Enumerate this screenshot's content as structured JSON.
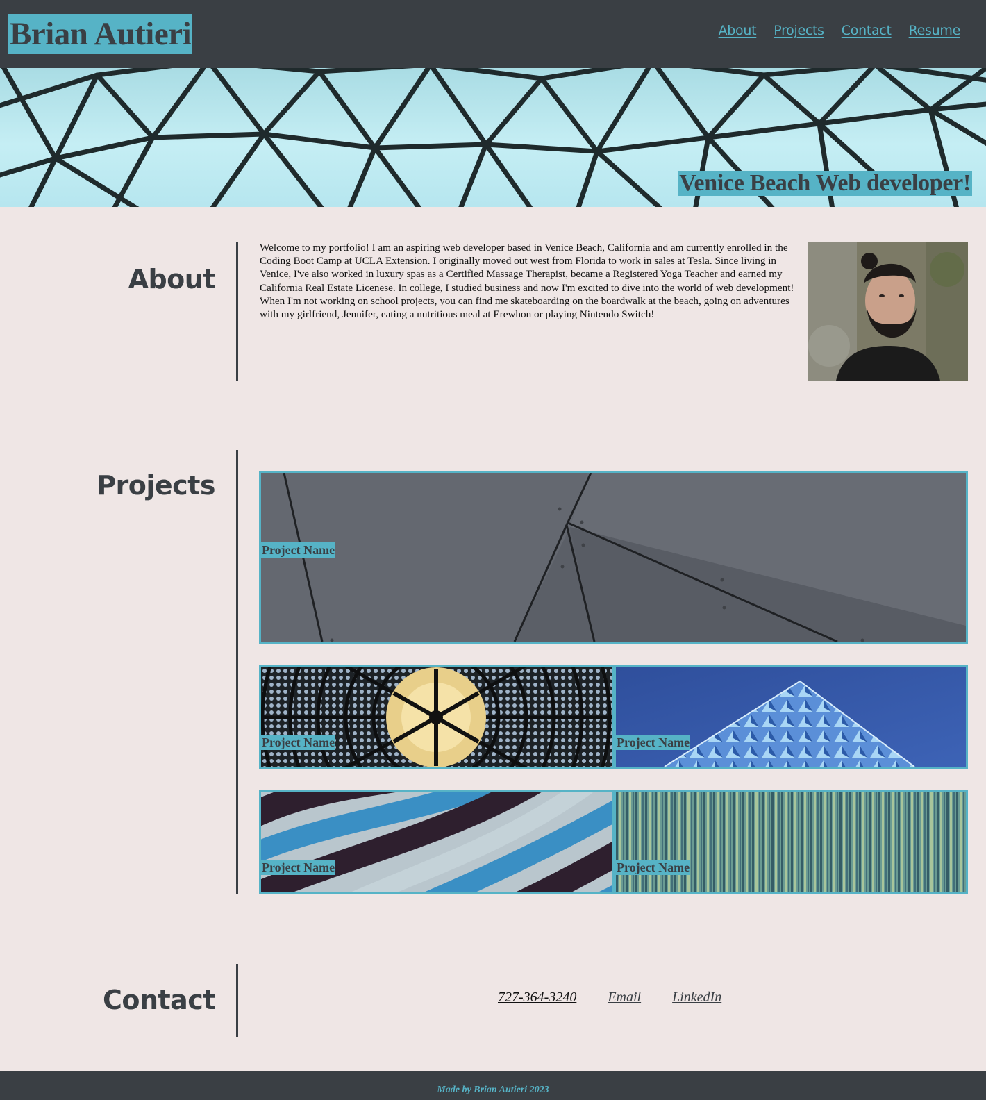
{
  "header": {
    "title": "Brian Autieri",
    "nav": [
      "About",
      "Projects",
      "Contact",
      "Resume"
    ]
  },
  "hero": {
    "tagline": "Venice Beach Web developer!"
  },
  "about": {
    "heading": "About",
    "text": "Welcome to my portfolio! I am an aspiring web developer based in Venice Beach, California and am currently enrolled in the Coding Boot Camp at UCLA Extension. I originally moved out west from Florida to work in sales at Tesla. Since living in Venice, I've also worked in luxury spas as a Certified Massage Therapist, became a Registered Yoga Teacher and earned my California Real Estate Licenese. In college, I studied business and now I'm excited to dive into the world of web development! When I'm not working on school projects, you can find me skateboarding on the boardwalk at the beach, going on adventures with my girlfriend, Jennifer, eating a nutritious meal at Erewhon or playing Nintendo Switch!"
  },
  "projects": {
    "heading": "Projects",
    "items": [
      {
        "label": "Project Name"
      },
      {
        "label": "Project Name"
      },
      {
        "label": "Project Name"
      },
      {
        "label": "Project Name"
      },
      {
        "label": "Project Name"
      }
    ]
  },
  "contact": {
    "heading": "Contact",
    "phone": "727-364-3240",
    "email": "Email",
    "linkedin": "LinkedIn"
  },
  "footer": {
    "text": "Made by Brian Autieri 2023"
  },
  "colors": {
    "dark": "#3a3f44",
    "accent": "#56b3c6",
    "background": "#efe6e5"
  }
}
